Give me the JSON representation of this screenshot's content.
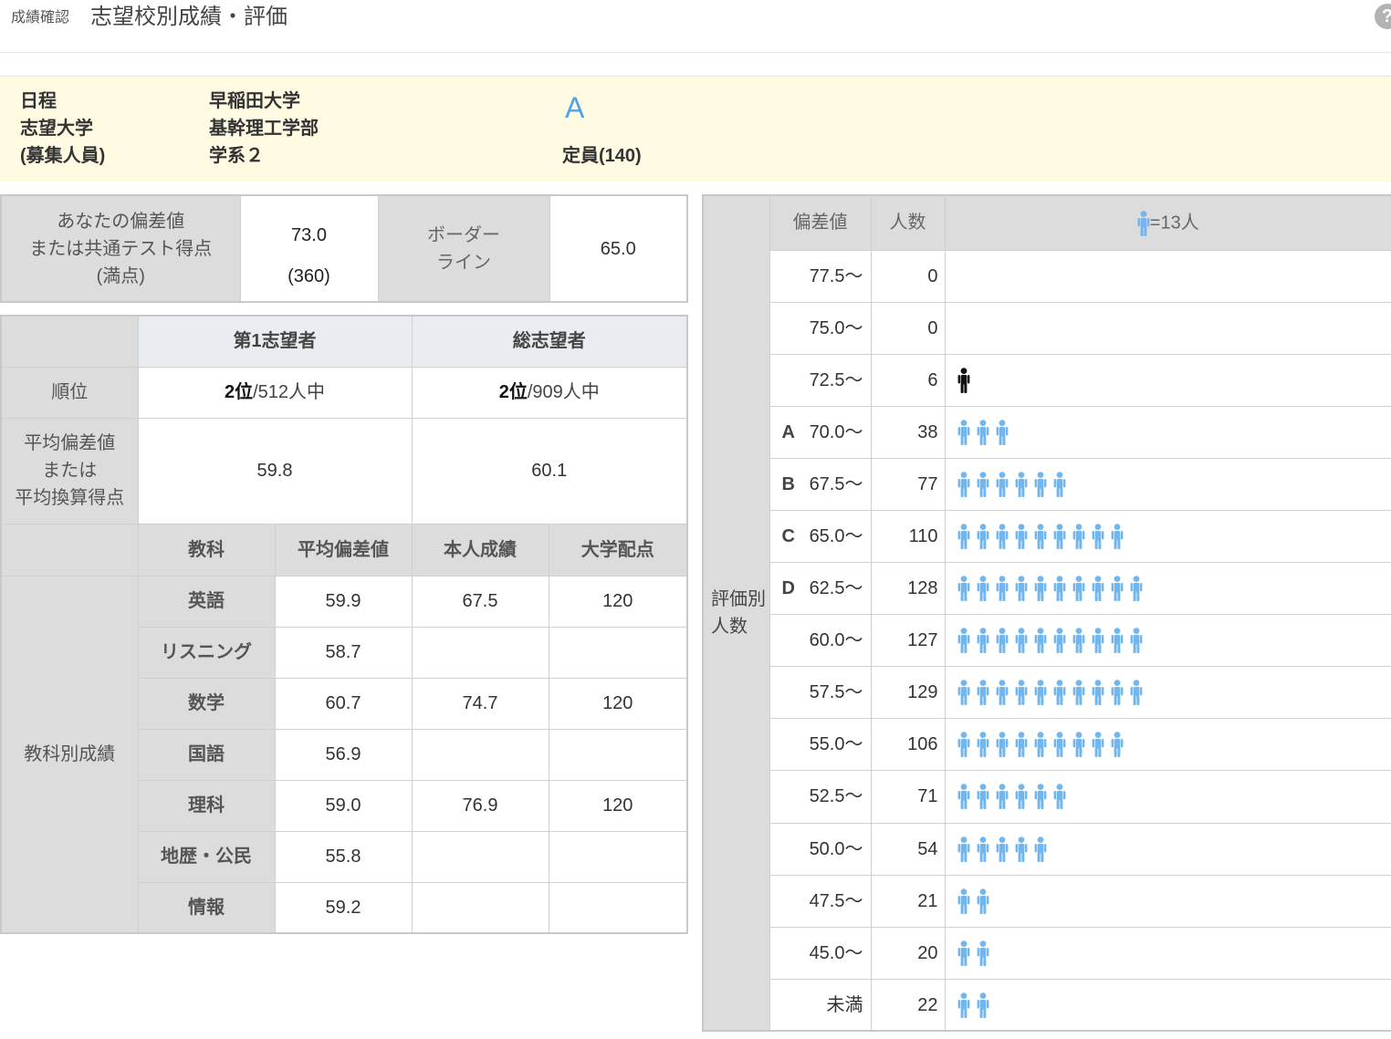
{
  "header": {
    "breadcrumb": "成績確認",
    "title": "志望校別成績・評価",
    "help_icon": "?"
  },
  "info": {
    "labels": [
      "日程",
      "志望大学",
      "(募集人員)"
    ],
    "values": [
      "早稲田大学",
      "基幹理工学部",
      "学系２"
    ],
    "grade": "A",
    "grade_color": "#4da2ec",
    "capacity": "定員(140)"
  },
  "score": {
    "label_lines": [
      "あなたの偏差値",
      "または共通テスト得点",
      "(満点)"
    ],
    "value": "73.0",
    "full_score": "(360)",
    "border_label_lines": [
      "ボーダー",
      "ライン"
    ],
    "border_value": "65.0"
  },
  "ranking": {
    "headers": [
      "第1志望者",
      "総志望者"
    ],
    "rank_label": "順位",
    "ranks": [
      {
        "place": "2位",
        "of": "/512人中"
      },
      {
        "place": "2位",
        "of": "/909人中"
      }
    ],
    "average_label_lines": [
      "平均偏差値",
      "または",
      "平均換算得点"
    ],
    "averages": [
      "59.8",
      "60.1"
    ]
  },
  "subjects": {
    "section_label": "教科別成績",
    "columns": [
      "教科",
      "平均偏差値",
      "本人成績",
      "大学配点"
    ],
    "rows": [
      {
        "name": "英語",
        "average": "59.9",
        "score": "67.5",
        "points": "120"
      },
      {
        "name": "リスニング",
        "average": "58.7",
        "score": "",
        "points": ""
      },
      {
        "name": "数学",
        "average": "60.7",
        "score": "74.7",
        "points": "120"
      },
      {
        "name": "国語",
        "average": "56.9",
        "score": "",
        "points": ""
      },
      {
        "name": "理科",
        "average": "59.0",
        "score": "76.9",
        "points": "120"
      },
      {
        "name": "地歴・公民",
        "average": "55.8",
        "score": "",
        "points": ""
      },
      {
        "name": "情報",
        "average": "59.2",
        "score": "",
        "points": ""
      }
    ]
  },
  "distribution": {
    "section_label_lines": [
      "評価別",
      "人数"
    ],
    "columns": [
      "偏差値",
      "人数"
    ],
    "legend_label": "=13人",
    "people_per_icon": 13,
    "icon_color": "#72b6f0",
    "self_icon_color": "#111111",
    "rows": [
      {
        "range": "77.5〜",
        "count": "0",
        "icons": 0,
        "self": false
      },
      {
        "range": "75.0〜",
        "count": "0",
        "icons": 0,
        "self": false
      },
      {
        "range": "72.5〜",
        "count": "6",
        "icons": 1,
        "self": true
      },
      {
        "grade": "A",
        "range": "70.0〜",
        "count": "38",
        "icons": 3,
        "self": false
      },
      {
        "grade": "B",
        "range": "67.5〜",
        "count": "77",
        "icons": 6,
        "self": false
      },
      {
        "grade": "C",
        "range": "65.0〜",
        "count": "110",
        "icons": 9,
        "self": false
      },
      {
        "grade": "D",
        "range": "62.5〜",
        "count": "128",
        "icons": 10,
        "self": false
      },
      {
        "range": "60.0〜",
        "count": "127",
        "icons": 10,
        "self": false
      },
      {
        "range": "57.5〜",
        "count": "129",
        "icons": 10,
        "self": false
      },
      {
        "range": "55.0〜",
        "count": "106",
        "icons": 9,
        "self": false
      },
      {
        "range": "52.5〜",
        "count": "71",
        "icons": 6,
        "self": false
      },
      {
        "range": "50.0〜",
        "count": "54",
        "icons": 5,
        "self": false
      },
      {
        "range": "47.5〜",
        "count": "21",
        "icons": 2,
        "self": false
      },
      {
        "range": "45.0〜",
        "count": "20",
        "icons": 2,
        "self": false
      },
      {
        "range": "未満",
        "count": "22",
        "icons": 2,
        "self": false
      }
    ]
  }
}
